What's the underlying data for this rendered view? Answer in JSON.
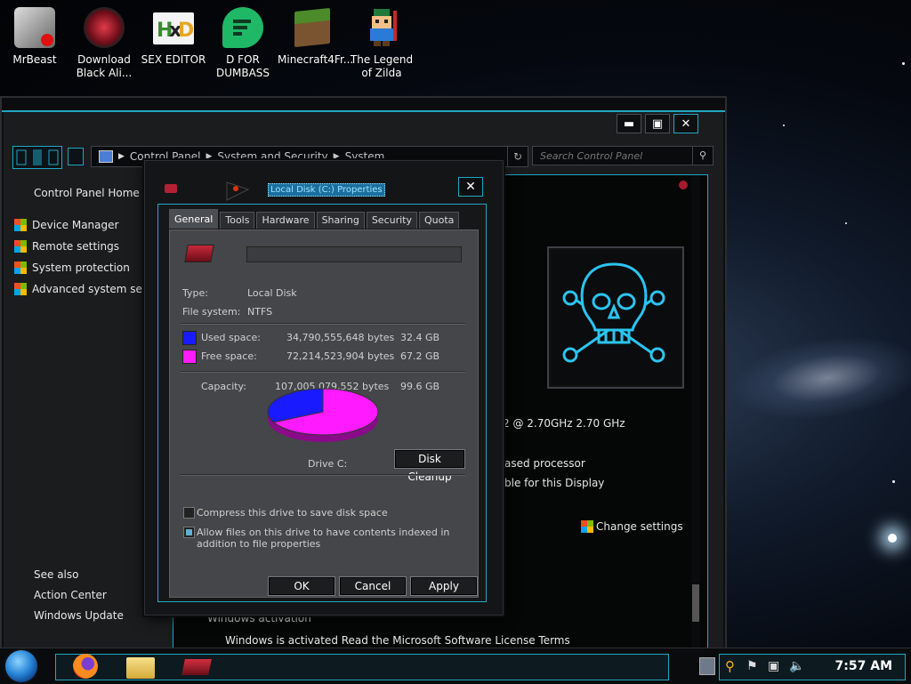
{
  "desktop": {
    "icons": [
      {
        "label": "MrBeast"
      },
      {
        "label": "Download Black Ali..."
      },
      {
        "label": "SEX EDITOR"
      },
      {
        "label": "D FOR DUMBASS"
      },
      {
        "label": "Minecraft4Fr..."
      },
      {
        "label": "The Legend of Zilda"
      }
    ]
  },
  "window": {
    "address": {
      "crumbs": [
        "Control Panel",
        "System and Security",
        "System"
      ]
    },
    "search_placeholder": "Search Control Panel",
    "left_pane": {
      "home": "Control Panel Home",
      "tasks": [
        "Device Manager",
        "Remote settings",
        "System protection",
        "Advanced system settings"
      ],
      "see_also": "See also",
      "see_also_links": [
        "Action Center",
        "Windows Update"
      ]
    },
    "right_pane": {
      "cpu_text": "2 @ 2.70GHz   2.70 GHz",
      "system_type_fragment": "ased processor",
      "pen_fragment": "ble for this Display",
      "change_settings": "Change settings",
      "activation_heading": "Windows activation",
      "activation_text": "Windows is activated   Read the Microsoft Software License Terms"
    }
  },
  "dialog": {
    "title": "Local Disk (C:) Properties",
    "tabs": [
      "General",
      "Tools",
      "Hardware",
      "Sharing",
      "Security",
      "Quota"
    ],
    "active_tab": "General",
    "drive_label_value": "",
    "type_label": "Type:",
    "type_value": "Local Disk",
    "fs_label": "File system:",
    "fs_value": "NTFS",
    "used_label": "Used space:",
    "used_bytes": "34,790,555,648 bytes",
    "used_gb": "32.4 GB",
    "free_label": "Free space:",
    "free_bytes": "72,214,523,904 bytes",
    "free_gb": "67.2 GB",
    "capacity_label": "Capacity:",
    "capacity_bytes": "107,005,079,552 bytes",
    "capacity_gb": "99.6 GB",
    "drive_caption": "Drive C:",
    "disk_cleanup": "Disk Cleanup",
    "compress_label": "Compress this drive to save disk space",
    "compress_checked": false,
    "index_label": "Allow files on this drive to have contents indexed in addition to file properties",
    "index_checked": true,
    "ok": "OK",
    "cancel": "Cancel",
    "apply": "Apply",
    "used_color": "#1a1aff",
    "free_color": "#ff1aff",
    "used_fraction": 0.325
  },
  "taskbar": {
    "clock": "7:57 AM"
  }
}
